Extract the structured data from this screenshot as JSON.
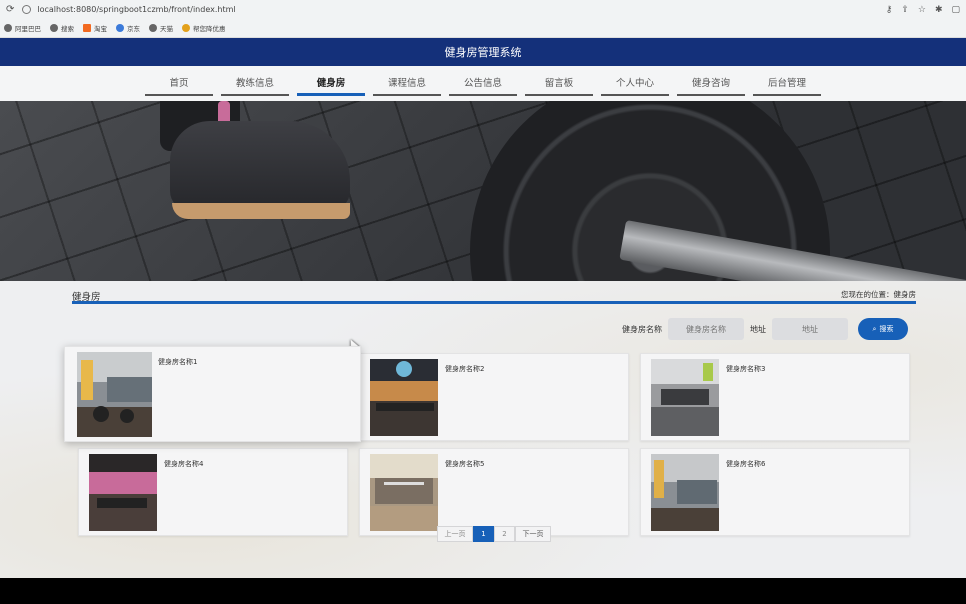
{
  "browser": {
    "url": "localhost:8080/springboot1czmb/front/index.html",
    "bookmarks": [
      "阿里巴巴",
      "搜索",
      "淘宝",
      "京东",
      "天猫",
      "帮您降优惠"
    ]
  },
  "header": {
    "title": "健身房管理系统"
  },
  "nav": {
    "items": [
      "首页",
      "教练信息",
      "健身房",
      "课程信息",
      "公告信息",
      "留言板",
      "个人中心",
      "健身咨询",
      "后台管理"
    ],
    "active_index": 2
  },
  "breadcrumb": {
    "title": "健身房",
    "position": "您现在的位置：健身房"
  },
  "search": {
    "name_label": "健身房名称",
    "name_placeholder": "健身房名称",
    "address_label": "地址",
    "address_placeholder": "地址",
    "button_label": "搜索"
  },
  "cards": [
    {
      "name": "健身房名称1"
    },
    {
      "name": "健身房名称2"
    },
    {
      "name": "健身房名称3"
    },
    {
      "name": "健身房名称4"
    },
    {
      "name": "健身房名称5"
    },
    {
      "name": "健身房名称6"
    }
  ],
  "pagination": {
    "prev": "上一页",
    "pages": [
      "1",
      "2"
    ],
    "current": "1",
    "next": "下一页"
  },
  "colors": {
    "header": "#14307a",
    "accent": "#1760b8"
  }
}
